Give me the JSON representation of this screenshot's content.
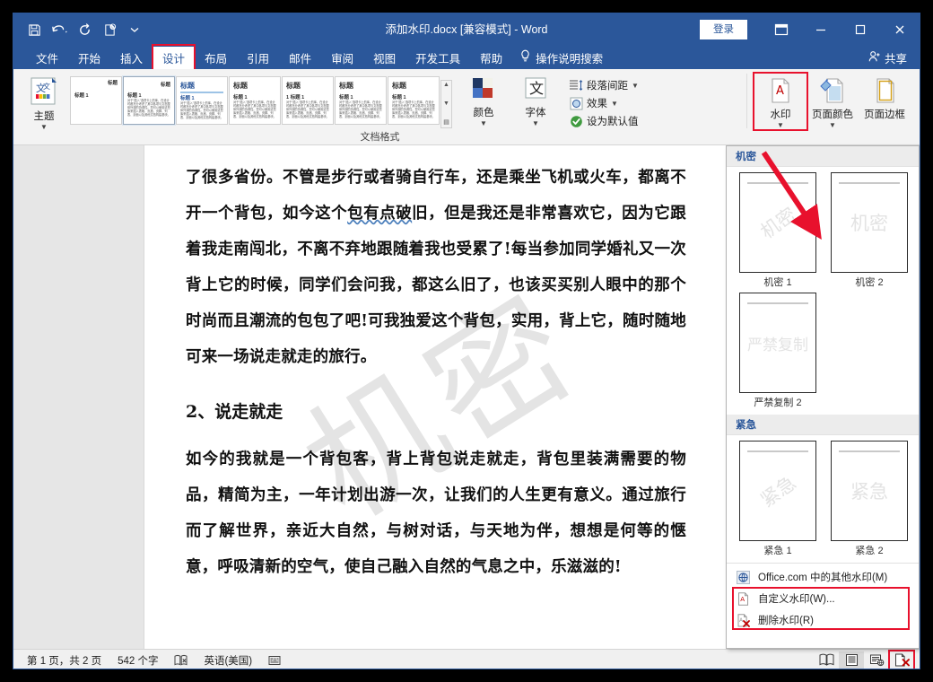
{
  "window": {
    "title": "添加水印.docx [兼容模式]  -  Word",
    "signin_label": "登录",
    "qat": [
      {
        "name": "save-icon",
        "tip": "保存"
      },
      {
        "name": "undo-icon",
        "tip": "撤消"
      },
      {
        "name": "redo-icon",
        "tip": "重复"
      },
      {
        "name": "touch-mode-icon",
        "tip": "触摸/鼠标模式"
      },
      {
        "name": "customize-qat-icon",
        "tip": "自定义快速访问工具栏"
      }
    ],
    "controls": {
      "ribbon_display": "功能区显示选项",
      "minimize": "最小化",
      "restore": "最大化",
      "close": "关闭"
    }
  },
  "tabs": [
    {
      "label": "文件",
      "active": false,
      "boxed": false
    },
    {
      "label": "开始",
      "active": false,
      "boxed": false
    },
    {
      "label": "插入",
      "active": false,
      "boxed": false
    },
    {
      "label": "设计",
      "active": true,
      "boxed": true
    },
    {
      "label": "布局",
      "active": false,
      "boxed": false
    },
    {
      "label": "引用",
      "active": false,
      "boxed": false
    },
    {
      "label": "邮件",
      "active": false,
      "boxed": false
    },
    {
      "label": "审阅",
      "active": false,
      "boxed": false
    },
    {
      "label": "视图",
      "active": false,
      "boxed": false
    },
    {
      "label": "开发工具",
      "active": false,
      "boxed": false
    },
    {
      "label": "帮助",
      "active": false,
      "boxed": false
    }
  ],
  "tell_me": "操作说明搜索",
  "share": "共享",
  "ribbon": {
    "group_doc_format_label": "文档格式",
    "theme_button": "主题",
    "gallery_items": [
      {
        "title": "标题",
        "heading": "标题 1",
        "variant": "plain"
      },
      {
        "title": "标题",
        "heading": "标题 1",
        "variant": "lines"
      },
      {
        "title": "标题",
        "heading": "标题 1",
        "variant": "blue"
      },
      {
        "title": "标题",
        "heading": "标题 1",
        "variant": "lines"
      },
      {
        "title": "标题",
        "heading": "1 标题 1",
        "variant": "numbered"
      },
      {
        "title": "标题",
        "heading": "标题 1",
        "variant": "plain"
      },
      {
        "title": "标题",
        "heading": "标题 1",
        "variant": "plain"
      }
    ],
    "gallery_sample_text": "对于“插入”选项卡上的库，在设计时都充分考虑了其中各项与文档整体外观的协调性。您可以使用这些库来插入表格、页眉、页脚、列表、封面以及其他文档构建基块。",
    "colors_button": "颜色",
    "fonts_button": "字体",
    "paragraph_spacing_button": "段落间距",
    "effects_button": "效果",
    "set_default_button": "设为默认值",
    "watermark_button": "水印",
    "page_color_button": "页面颜色",
    "page_borders_button": "页面边框"
  },
  "watermark_panel": {
    "sections": [
      {
        "header": "机密",
        "items": [
          {
            "caption": "机密 1",
            "text": "机密",
            "style": "diag"
          },
          {
            "caption": "机密 2",
            "text": "机密",
            "style": "horiz"
          },
          {
            "caption": "严禁复制 2",
            "text": "严禁复制",
            "style": "horiz"
          }
        ]
      },
      {
        "header": "紧急",
        "items": [
          {
            "caption": "紧急 1",
            "text": "紧急",
            "style": "diag"
          },
          {
            "caption": "紧急 2",
            "text": "紧急",
            "style": "horiz"
          }
        ]
      }
    ],
    "menu": [
      {
        "label": "Office.com 中的其他水印(M)",
        "icon": "office-online-icon",
        "boxed": false
      },
      {
        "label": "自定义水印(W)...",
        "icon": "custom-watermark-icon",
        "boxed": true
      },
      {
        "label": "删除水印(R)",
        "icon": "remove-watermark-icon",
        "boxed": true
      }
    ]
  },
  "document": {
    "paragraph_1": "了很多省份。不管是步行或者骑自行车，还是乘坐飞机或火车，都离不开一个背包，如今这个",
    "paragraph_1_spell": "包有点破",
    "paragraph_1_b": "旧，但是我还是非常喜欢它，因为它跟着我走南闯北，不离不弃地跟随着我也受累了!每当参加同学婚礼又一次背上它的时候，同学们会问我，都这么旧了，也该买买别人眼中的那个时尚而且潮流的包包了吧!可我独爱这个背包，实用，背上它，随时随地可来一场说走就走的旅行。",
    "heading_2": "2、说走就走",
    "paragraph_2": "如今的我就是一个背包客，背上背包说走就走，背包里装满需要的物品，精简为主，一年计划出游一次，让我们的人生更有意义。通过旅行而了解世界，亲近大自然，与树对话，与天地为伴，想想是何等的惬意，呼吸清新的空气，使自己融入自然的气息之中，乐滋滋的!",
    "watermark_text": "机密"
  },
  "statusbar": {
    "page_info": "第 1 页，共 2 页",
    "word_count": "542 个字",
    "proofing_icon": "proofing-errors-icon",
    "language": "英语(美国)",
    "accessibility_icon": "accessibility-icon",
    "views": [
      {
        "name": "read-mode-view",
        "active": false,
        "boxed": false
      },
      {
        "name": "print-layout-view",
        "active": true,
        "boxed": false
      },
      {
        "name": "web-layout-view",
        "active": false,
        "boxed": false
      },
      {
        "name": "close-preview-view",
        "active": false,
        "boxed": true
      }
    ]
  }
}
